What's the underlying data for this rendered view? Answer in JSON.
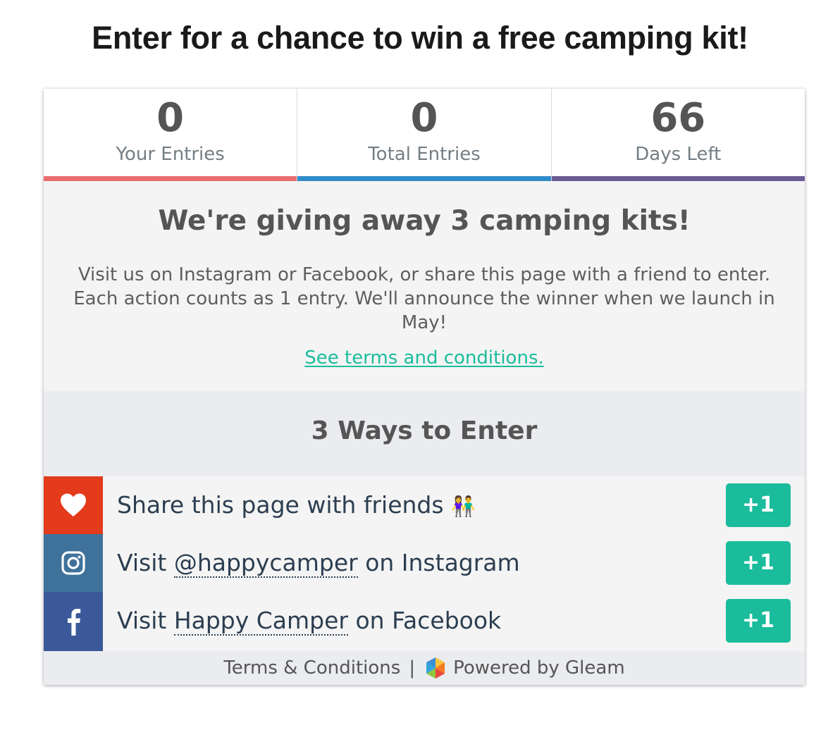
{
  "page": {
    "title": "Enter for a chance to win a free camping kit!"
  },
  "stats": [
    {
      "value": "0",
      "label": "Your Entries",
      "color": "#e96d6d"
    },
    {
      "value": "0",
      "label": "Total Entries",
      "color": "#2f8bc8"
    },
    {
      "value": "66",
      "label": "Days Left",
      "color": "#6b5b95"
    }
  ],
  "description": {
    "heading": "We're giving away 3 camping kits!",
    "body": "Visit us on Instagram or Facebook, or share this page with a friend to enter. Each action counts as 1 entry. We'll announce the winner when we launch in May!",
    "terms_link": "See terms and conditions."
  },
  "ways": {
    "title": "3 Ways to Enter"
  },
  "entries": [
    {
      "prefix": "Share this page with friends",
      "emoji": "👫",
      "icon": "heart-icon",
      "color": "#e33b1b",
      "points": "+1"
    },
    {
      "prefix": "Visit ",
      "link": "@happycamper",
      "suffix": " on Instagram",
      "icon": "instagram-icon",
      "color": "#3f729b",
      "points": "+1"
    },
    {
      "prefix": "Visit ",
      "link": "Happy Camper",
      "suffix": " on Facebook",
      "icon": "facebook-icon",
      "color": "#3b5998",
      "points": "+1"
    }
  ],
  "footer": {
    "terms": "Terms & Conditions",
    "separator": "|",
    "powered": "Powered by Gleam"
  },
  "colors": {
    "accent": "#1abc9c"
  }
}
